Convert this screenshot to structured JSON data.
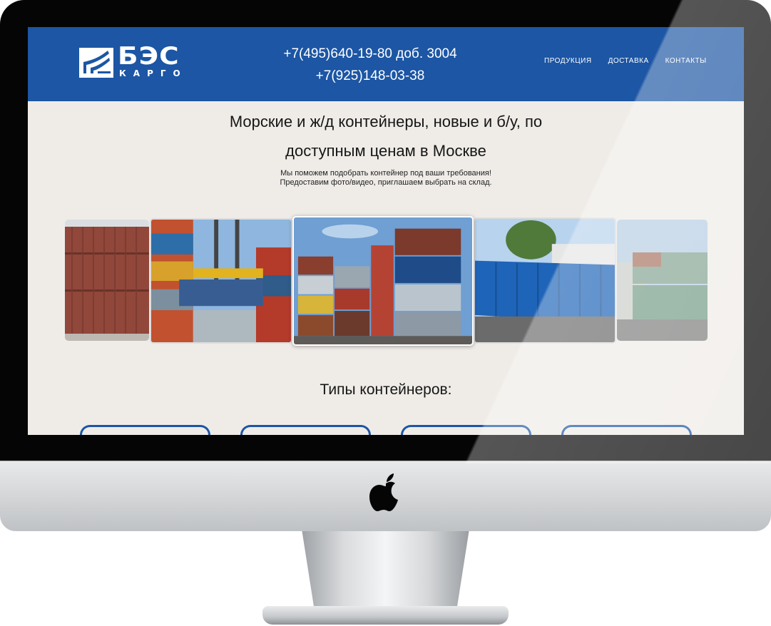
{
  "logo": {
    "main": "БЭС",
    "sub": "КАРГО"
  },
  "header": {
    "phone1": "+7(495)640-19-80 доб. 3004",
    "phone2": "+7(925)148-03-38"
  },
  "nav": [
    {
      "label": "ПРОДУКЦИЯ"
    },
    {
      "label": "ДОСТАВКА"
    },
    {
      "label": "КОНТАКТЫ"
    }
  ],
  "hero": {
    "title_line1": "Морские и ж/д контейнеры, новые и б/у, по",
    "title_line2": "доступным ценам в Москве",
    "sub_line1": "Мы поможем подобрать контейнер под ваши требования!",
    "sub_line2": "Предоставим фото/видео, приглашаем выбрать на склад."
  },
  "sections": {
    "types_title": "Типы контейнеров:"
  },
  "colors": {
    "header_blue": "#1c56a4",
    "page_bg": "#efece8"
  },
  "icons": {
    "device_logo": "apple-icon"
  }
}
